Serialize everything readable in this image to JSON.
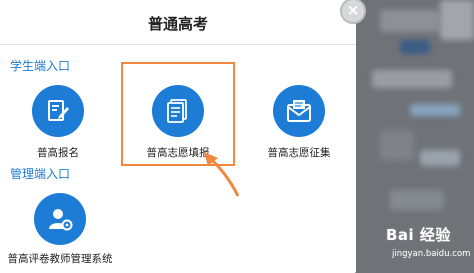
{
  "modal": {
    "title": "普通高考",
    "close_label": "×"
  },
  "student_section": {
    "label": "学生端入口",
    "tiles": [
      {
        "label": "普高报名",
        "icon": "edit-document-icon"
      },
      {
        "label": "普高志愿填报",
        "icon": "document-list-icon"
      },
      {
        "label": "普高志愿征集",
        "icon": "envelope-icon"
      }
    ]
  },
  "manager_section": {
    "label": "管理端入口",
    "tiles": [
      {
        "label": "普高评卷教师管理系统",
        "icon": "user-settings-icon"
      }
    ]
  },
  "watermark": {
    "main": "Bai 经验",
    "sub": "jingyan.baidu.com"
  },
  "colors": {
    "accent": "#1c7cd6",
    "highlight": "#f0883e"
  }
}
